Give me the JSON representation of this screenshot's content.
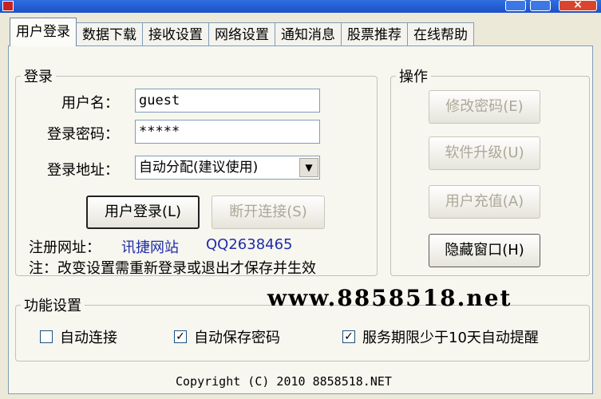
{
  "window": {
    "close_glyph": "×"
  },
  "tabs": [
    "用户登录",
    "数据下载",
    "接收设置",
    "网络设置",
    "通知消息",
    "股票推荐",
    "在线帮助"
  ],
  "login": {
    "group_title": "登录",
    "username_label": "用户名：",
    "username_value": "guest",
    "password_label": "登录密码：",
    "password_value": "*****",
    "address_label": "登录地址：",
    "address_value": "自动分配(建议使用)",
    "login_button": "用户登录(L)",
    "disconnect_button": "断开连接(S)",
    "reg_label": "注册网址：",
    "reg_link": "讯捷网站",
    "qq": "QQ2638465",
    "note": "注：改变设置需重新登录或退出才保存并生效"
  },
  "ops": {
    "group_title": "操作",
    "change_password": "修改密码(E)",
    "upgrade": "软件升级(U)",
    "recharge": "用户充值(A)",
    "hide_window": "隐藏窗口(H)"
  },
  "func": {
    "group_title": "功能设置",
    "auto_connect": "自动连接",
    "auto_save_password": "自动保存密码",
    "expiry_reminder": "服务期限少于10天自动提醒",
    "check_mark": "✓"
  },
  "watermark": "www.8858518.net",
  "copyright": "Copyright (C) 2010 8858518.NET"
}
